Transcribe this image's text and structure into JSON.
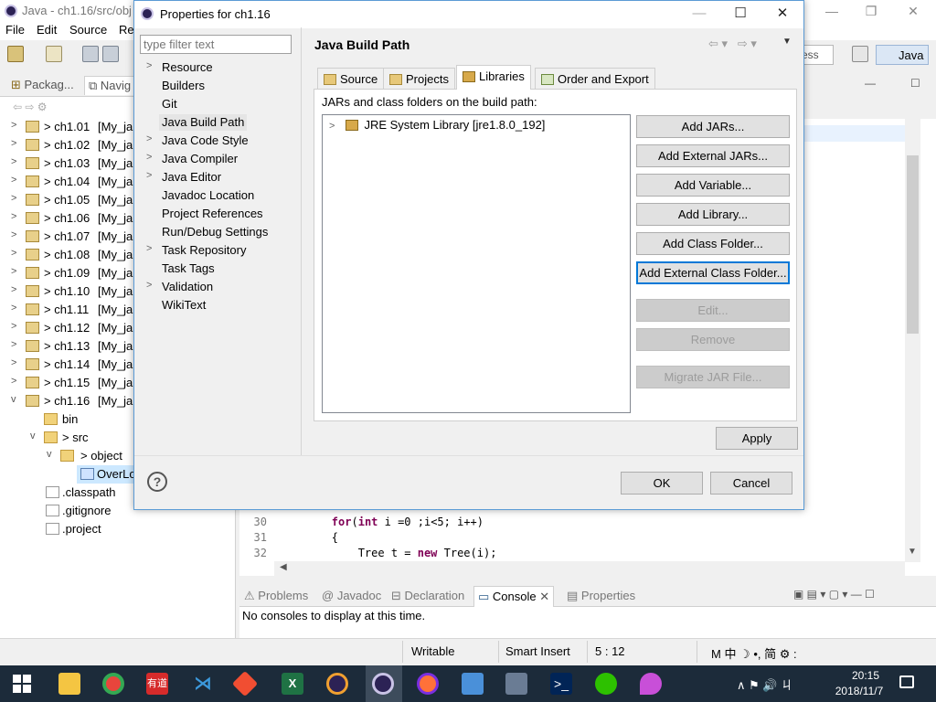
{
  "eclipse": {
    "title": "Java - ch1.16/src/obj",
    "menus": [
      "File",
      "Edit",
      "Source",
      "Re"
    ],
    "quick_access": "ess",
    "perspective": "Java",
    "package_explorer": {
      "tab1": "Packag...",
      "tab2": "Navig",
      "projects": [
        {
          "label": "> ch1.01",
          "suffix": "[My_ja"
        },
        {
          "label": "> ch1.02",
          "suffix": "[My_ja"
        },
        {
          "label": "> ch1.03",
          "suffix": "[My_ja"
        },
        {
          "label": "> ch1.04",
          "suffix": "[My_ja"
        },
        {
          "label": "> ch1.05",
          "suffix": "[My_ja"
        },
        {
          "label": "> ch1.06",
          "suffix": "[My_ja"
        },
        {
          "label": "> ch1.07",
          "suffix": "[My_ja"
        },
        {
          "label": "> ch1.08",
          "suffix": "[My_ja"
        },
        {
          "label": "> ch1.09",
          "suffix": "[My_ja"
        },
        {
          "label": "> ch1.10",
          "suffix": "[My_ja"
        },
        {
          "label": "> ch1.11",
          "suffix": "[My_ja"
        },
        {
          "label": "> ch1.12",
          "suffix": "[My_ja"
        },
        {
          "label": "> ch1.13",
          "suffix": "[My_ja"
        },
        {
          "label": "> ch1.14",
          "suffix": "[My_ja"
        },
        {
          "label": "> ch1.15",
          "suffix": "[My_ja"
        },
        {
          "label": "> ch1.16",
          "suffix": "[My_ja"
        }
      ],
      "children": {
        "bin": "bin",
        "src": "> src",
        "object": "> object",
        "overlo": "OverLo",
        "classpath": ".classpath",
        "gitignore": ".gitignore",
        "project": ".project"
      }
    },
    "editor": {
      "lines": [
        {
          "no": "30",
          "code": [
            {
              "t": "for",
              "kw": true
            },
            {
              "t": "(",
              "kw": false
            },
            {
              "t": "int",
              "kw": true
            },
            {
              "t": " i =0 ;i<5; i++)",
              "kw": false
            }
          ]
        },
        {
          "no": "31",
          "code": [
            {
              "t": "{",
              "kw": false
            }
          ]
        },
        {
          "no": "32",
          "code": [
            {
              "t": "    Tree t = ",
              "kw": false
            },
            {
              "t": "new",
              "kw": true
            },
            {
              "t": " Tree(i);",
              "kw": false
            }
          ]
        }
      ]
    },
    "bottom_tabs": [
      "Problems",
      "Javadoc",
      "Declaration",
      "Console",
      "Properties"
    ],
    "console_message": "No consoles to display at this time.",
    "status": {
      "writable": "Writable",
      "insert_mode": "Smart Insert",
      "position": "5 : 12"
    },
    "ime": "M 中 ☽ •, 简 ⚙ :"
  },
  "dialog": {
    "title": "Properties for ch1.16",
    "filter_placeholder": "type filter text",
    "nav_items": [
      {
        "label": "Resource",
        "expandable": true
      },
      {
        "label": "Builders",
        "expandable": false
      },
      {
        "label": "Git",
        "expandable": false
      },
      {
        "label": "Java Build Path",
        "expandable": false,
        "selected": true
      },
      {
        "label": "Java Code Style",
        "expandable": true
      },
      {
        "label": "Java Compiler",
        "expandable": true
      },
      {
        "label": "Java Editor",
        "expandable": true
      },
      {
        "label": "Javadoc Location",
        "expandable": false
      },
      {
        "label": "Project References",
        "expandable": false
      },
      {
        "label": "Run/Debug Settings",
        "expandable": false
      },
      {
        "label": "Task Repository",
        "expandable": true
      },
      {
        "label": "Task Tags",
        "expandable": false
      },
      {
        "label": "Validation",
        "expandable": true
      },
      {
        "label": "WikiText",
        "expandable": false
      }
    ],
    "page_title": "Java Build Path",
    "tabs": [
      "Source",
      "Projects",
      "Libraries",
      "Order and Export"
    ],
    "active_tab": "Libraries",
    "build_path_label": "JARs and class folders on the build path:",
    "libraries": [
      "JRE System Library [jre1.8.0_192]"
    ],
    "buttons": {
      "add_jars": "Add JARs...",
      "add_external_jars": "Add External JARs...",
      "add_variable": "Add Variable...",
      "add_library": "Add Library...",
      "add_class_folder": "Add Class Folder...",
      "add_external_class_folder": "Add External Class Folder...",
      "edit": "Edit...",
      "remove": "Remove",
      "migrate": "Migrate JAR File...",
      "apply": "Apply",
      "ok": "OK",
      "cancel": "Cancel"
    }
  },
  "taskbar": {
    "time": "20:15",
    "date": "2018/11/7",
    "tray_text": "∧ ⚑ 🔊 ㄐ"
  },
  "colors": {
    "accent": "#0078d7",
    "taskbar": "#1c2b3a",
    "keyword": "#7f0055",
    "dialog_border": "#5b9bd5"
  }
}
